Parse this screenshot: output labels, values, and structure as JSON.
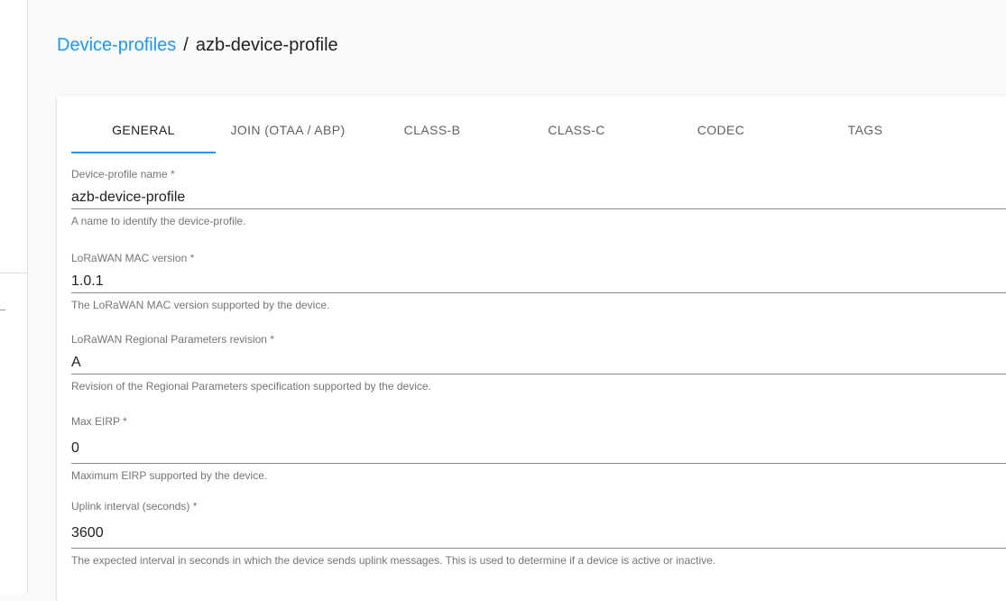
{
  "breadcrumb": {
    "parent": "Device-profiles",
    "separator": "/",
    "current": "azb-device-profile"
  },
  "tabs": [
    {
      "label": "GENERAL",
      "active": true
    },
    {
      "label": "JOIN (OTAA / ABP)",
      "active": false
    },
    {
      "label": "CLASS-B",
      "active": false
    },
    {
      "label": "CLASS-C",
      "active": false
    },
    {
      "label": "CODEC",
      "active": false
    },
    {
      "label": "TAGS",
      "active": false
    }
  ],
  "form": {
    "name": {
      "label": "Device-profile name *",
      "value": "azb-device-profile",
      "helper": "A name to identify the device-profile."
    },
    "mac_version": {
      "label": "LoRaWAN MAC version *",
      "value": "1.0.1",
      "helper": "The LoRaWAN MAC version supported by the device."
    },
    "reg_params": {
      "label": "LoRaWAN Regional Parameters revision *",
      "value": "A",
      "helper": "Revision of the Regional Parameters specification supported by the device."
    },
    "max_eirp": {
      "label": "Max EIRP *",
      "value": "0",
      "helper": "Maximum EIRP supported by the device."
    },
    "uplink_interval": {
      "label": "Uplink interval (seconds) *",
      "value": "3600",
      "helper": "The expected interval in seconds in which the device sends uplink messages. This is used to determine if a device is active or inactive."
    }
  },
  "colors": {
    "accent": "#2196f3",
    "text": "#212121",
    "muted": "#757575"
  }
}
